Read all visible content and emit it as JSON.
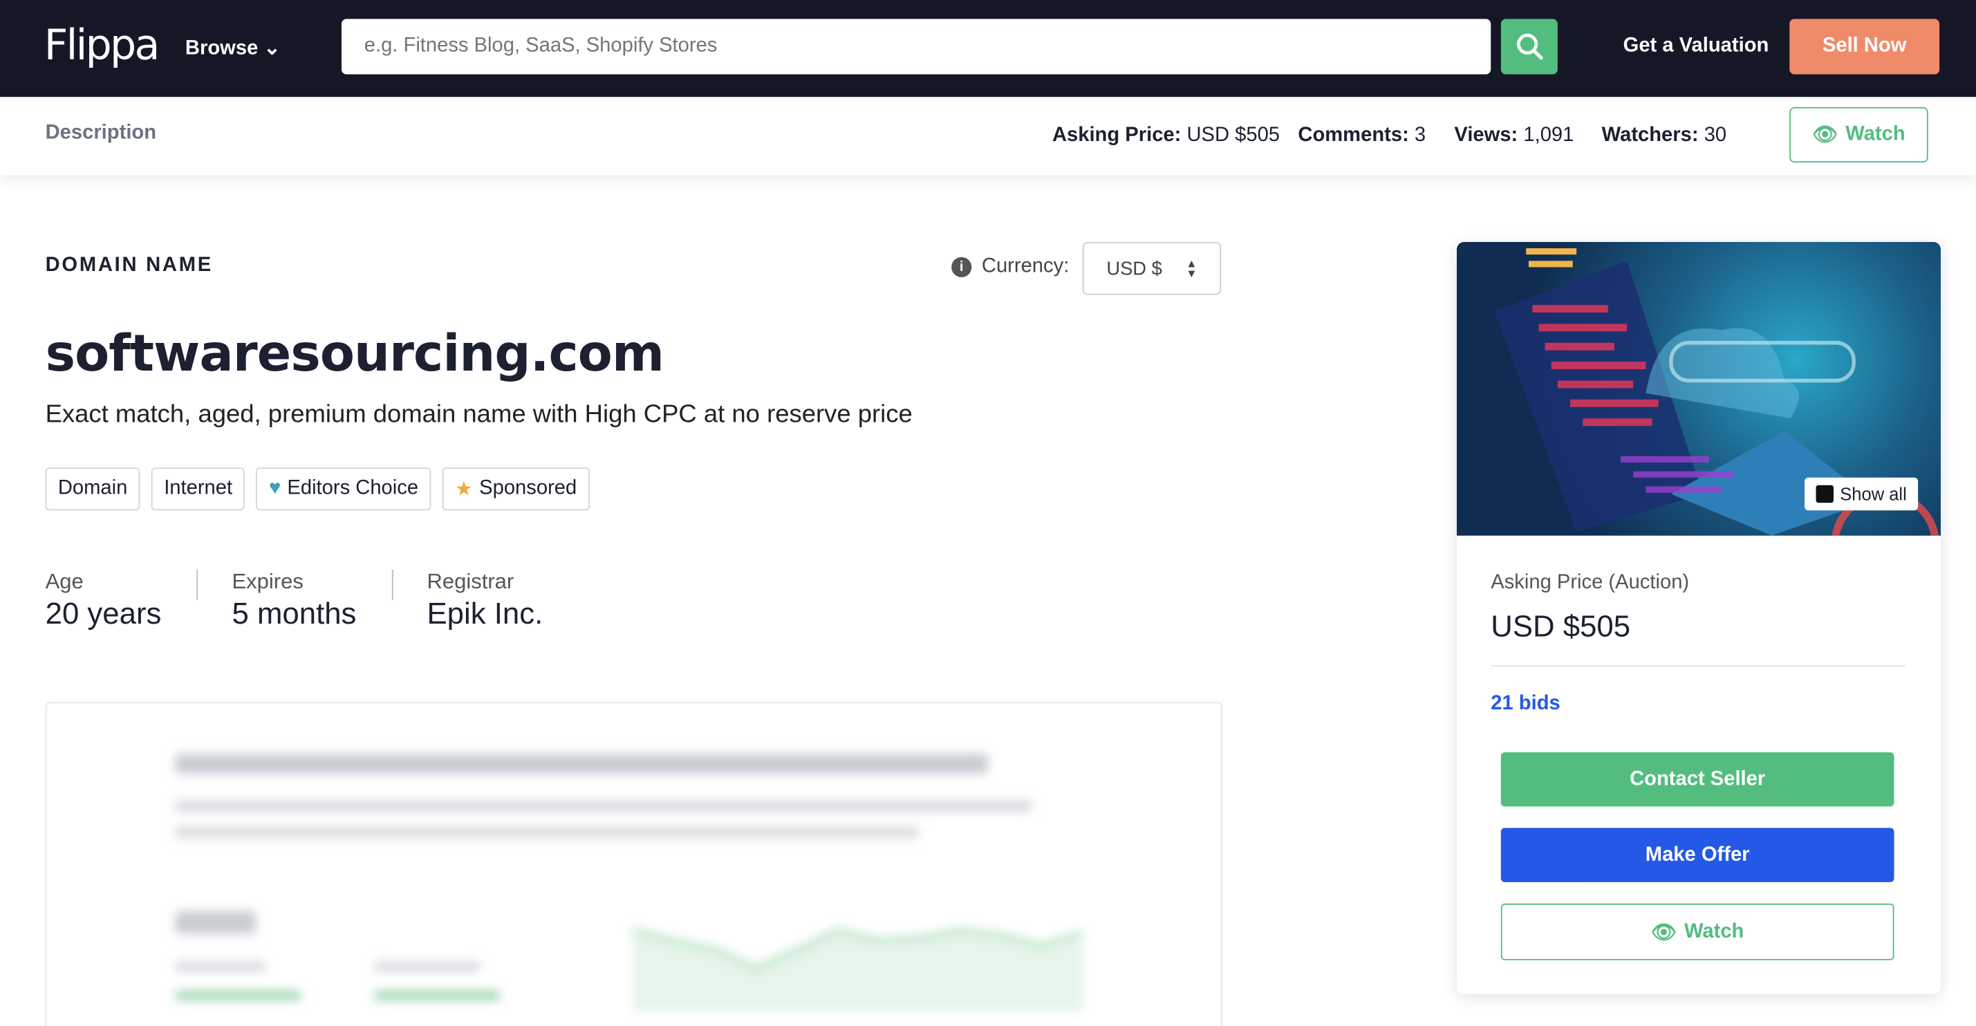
{
  "header": {
    "logo": "Flippa",
    "browse": "Browse",
    "search_placeholder": "e.g. Fitness Blog, SaaS, Shopify Stores",
    "valuation": "Get a Valuation",
    "sell": "Sell Now"
  },
  "subnav": {
    "description": "Description",
    "asking_label": "Asking Price:",
    "asking_value": "USD $505",
    "comments_label": "Comments:",
    "comments_value": "3",
    "views_label": "Views:",
    "views_value": "1,091",
    "watchers_label": "Watchers:",
    "watchers_value": "30",
    "watch": "Watch"
  },
  "listing": {
    "kicker": "DOMAIN NAME",
    "currency_label": "Currency:",
    "currency_value": "USD $",
    "title": "softwaresourcing.com",
    "tagline": "Exact match, aged, premium domain name with High CPC at no reserve price",
    "tags": [
      {
        "label": "Domain"
      },
      {
        "label": "Internet"
      },
      {
        "label": "Editors Choice",
        "icon": "heart-icon"
      },
      {
        "label": "Sponsored",
        "icon": "star-icon"
      }
    ],
    "facts": [
      {
        "label": "Age",
        "value": "20 years"
      },
      {
        "label": "Expires",
        "value": "5 months"
      },
      {
        "label": "Registrar",
        "value": "Epik Inc."
      }
    ]
  },
  "card": {
    "show_all": "Show all",
    "price_label": "Asking Price (Auction)",
    "price_value": "USD $505",
    "bids": "21 bids",
    "contact": "Contact Seller",
    "offer": "Make Offer",
    "watch": "Watch"
  },
  "colors": {
    "nav": "#151726",
    "green": "#52bd7f",
    "orange": "#f08b6a",
    "blue": "#2458e6"
  }
}
